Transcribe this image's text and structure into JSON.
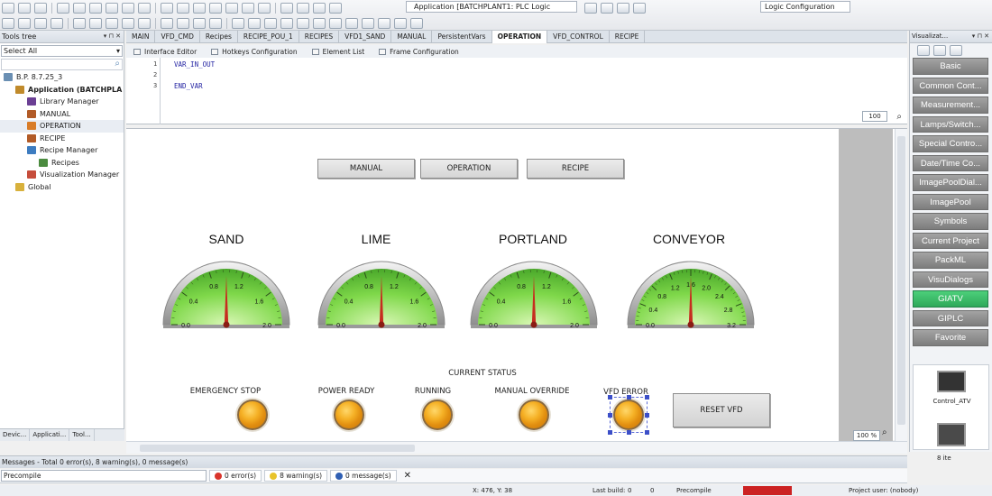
{
  "toolbar": {
    "app_combo": "Application [BATCHPLANT1: PLC Logic",
    "logic_combo": "Logic Configuration"
  },
  "tools_tree": {
    "title": "Tools tree",
    "select_label": "Select All",
    "items": [
      {
        "label": "B.P. 8.7.25_3",
        "indent": 0
      },
      {
        "label": "Application (BATCHPLA",
        "indent": 1,
        "bold": true
      },
      {
        "label": "Library Manager",
        "indent": 2
      },
      {
        "label": "MANUAL",
        "indent": 2
      },
      {
        "label": "OPERATION",
        "indent": 2,
        "selected": true
      },
      {
        "label": "RECIPE",
        "indent": 2
      },
      {
        "label": "Recipe Manager",
        "indent": 2
      },
      {
        "label": "Recipes",
        "indent": 3
      },
      {
        "label": "Visualization Manager",
        "indent": 2
      },
      {
        "label": "Global",
        "indent": 1
      }
    ],
    "bottom_tabs": [
      "Devic...",
      "Applicati...",
      "Tool..."
    ]
  },
  "doc_tabs": [
    {
      "label": "MAIN"
    },
    {
      "label": "VFD_CMD"
    },
    {
      "label": "Recipes"
    },
    {
      "label": "RECIPE_POU_1"
    },
    {
      "label": "RECIPES"
    },
    {
      "label": "VFD1_SAND"
    },
    {
      "label": "MANUAL"
    },
    {
      "label": "PersistentVars"
    },
    {
      "label": "OPERATION",
      "active": true
    },
    {
      "label": "VFD_CONTROL"
    },
    {
      "label": "RECIPE"
    }
  ],
  "sub_tabs": [
    "Interface Editor",
    "Hotkeys Configuration",
    "Element List",
    "Frame Configuration"
  ],
  "code": {
    "lines": [
      "1",
      "2",
      "3"
    ],
    "line1": "VAR_IN_OUT",
    "line3": "END_VAR",
    "zoom": "100"
  },
  "canvas": {
    "nav_buttons": [
      "MANUAL",
      "OPERATION",
      "RECIPE"
    ],
    "gauges": [
      {
        "title": "SAND",
        "ticks": [
          "0.0",
          "0.4",
          "0.8",
          "1.2",
          "1.6",
          "2.0"
        ],
        "value": 1.0,
        "max": 2.0
      },
      {
        "title": "LIME",
        "ticks": [
          "0.0",
          "0.4",
          "0.8",
          "1.2",
          "1.6",
          "2.0"
        ],
        "value": 1.0,
        "max": 2.0
      },
      {
        "title": "PORTLAND",
        "ticks": [
          "0.0",
          "0.4",
          "0.8",
          "1.2",
          "1.6",
          "2.0"
        ],
        "value": 1.0,
        "max": 2.0
      },
      {
        "title": "CONVEYOR",
        "ticks": [
          "0.0",
          "0.4",
          "0.8",
          "1.2",
          "1.6",
          "2.0",
          "2.4",
          "2.8",
          "3.2"
        ],
        "value": 1.6,
        "max": 3.2
      }
    ],
    "status_title": "CURRENT STATUS",
    "lamps": [
      "EMERGENCY STOP",
      "POWER READY",
      "RUNNING",
      "MANUAL OVERRIDE",
      "VFD ERROR"
    ],
    "reset_button": "RESET VFD",
    "zoom": "100 %"
  },
  "visualization_toolbox": {
    "title": "Visualizat...",
    "categories": [
      {
        "label": "Basic"
      },
      {
        "label": "Common Cont..."
      },
      {
        "label": "Measurement..."
      },
      {
        "label": "Lamps/Switch..."
      },
      {
        "label": "Special Contro..."
      },
      {
        "label": "Date/Time Co..."
      },
      {
        "label": "ImagePoolDial..."
      },
      {
        "label": "ImagePool"
      },
      {
        "label": "Symbols"
      },
      {
        "label": "Current Project"
      },
      {
        "label": "PackML"
      },
      {
        "label": "VisuDialogs"
      },
      {
        "label": "GIATV",
        "active": true
      },
      {
        "label": "GIPLC"
      },
      {
        "label": "Favorite"
      }
    ],
    "item_label": "Control_ATV",
    "items_count": "8 ite"
  },
  "messages": {
    "bar": "Messages - Total 0 error(s), 8 warning(s), 0 message(s)",
    "combo": "Precompile",
    "errors": "0 error(s)",
    "warnings": "8 warning(s)",
    "infos": "0 message(s)"
  },
  "statusbar": {
    "coords": "X: 476, Y: 38",
    "last_build": "Last build:",
    "build_errors": "0",
    "build_warnings": "0",
    "precompile": "Precompile",
    "project_user": "Project user: (nobody)"
  },
  "colors": {
    "gauge_green": "#6fd13a",
    "needle": "#c62d1f",
    "lamp_orange": "#f5b126",
    "active_category": "#36b964"
  }
}
